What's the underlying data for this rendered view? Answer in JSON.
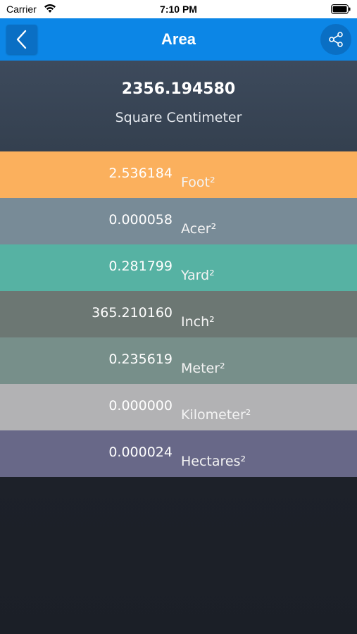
{
  "status_bar": {
    "carrier": "Carrier",
    "time": "7:10 PM"
  },
  "nav": {
    "title": "Area",
    "back_icon": "chevron-left-icon",
    "share_icon": "share-icon"
  },
  "result": {
    "value": "2356.194580",
    "unit": "Square Centimeter"
  },
  "rows": [
    {
      "value": "2.536184",
      "unit": "Foot²",
      "color": "#fbb05d"
    },
    {
      "value": "0.000058",
      "unit": "Acer²",
      "color": "#788b97"
    },
    {
      "value": "0.281799",
      "unit": "Yard²",
      "color": "#56b2a3"
    },
    {
      "value": "365.210160",
      "unit": "Inch²",
      "color": "#6c7773"
    },
    {
      "value": "0.235619",
      "unit": "Meter²",
      "color": "#778f8a"
    },
    {
      "value": "0.000000",
      "unit": "Kilometer²",
      "color": "#b2b2b4"
    },
    {
      "value": "0.000024",
      "unit": "Hectares²",
      "color": "#686888"
    }
  ]
}
